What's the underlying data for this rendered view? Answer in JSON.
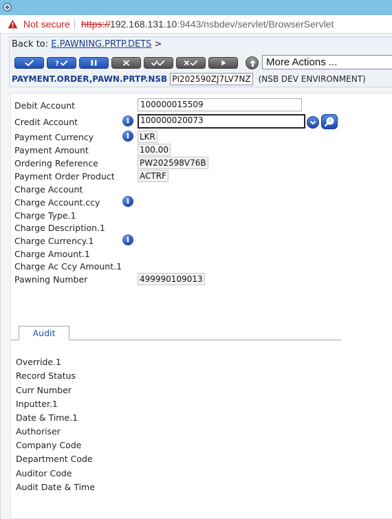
{
  "browser": {
    "security_label": "Not secure",
    "url_scheme": "https://",
    "url_host": "192.168.131.10",
    "url_path": ":9443/nsbdev/servlet/BrowserServlet"
  },
  "toolbar": {
    "back_prefix": "Back to:",
    "back_link": "E.PAWNING.PRTP.DETS",
    "back_suffix": ">",
    "more_actions": "More Actions ...",
    "buttons": [
      "commit-deal",
      "validate-deal",
      "hold-deal",
      "delete-deal",
      "authorise-deal",
      "reverse-deal",
      "next-record",
      "context-enquiry"
    ]
  },
  "header": {
    "app_title": "PAYMENT.ORDER,PAWN.PRTP.NSB",
    "record_id": "PI202590ZJ7LV7NZ",
    "environment": "(NSB DEV ENVIRONMENT)"
  },
  "fields": {
    "debit_account": {
      "label": "Debit Account",
      "value": "100000015509"
    },
    "credit_account": {
      "label": "Credit Account",
      "value": "100000020073"
    },
    "payment_currency": {
      "label": "Payment Currency",
      "value": "LKR"
    },
    "payment_amount": {
      "label": "Payment Amount",
      "value": "100.00"
    },
    "ordering_reference": {
      "label": "Ordering Reference",
      "value": "PW202598V76B"
    },
    "payment_order_product": {
      "label": "Payment Order Product",
      "value": "ACTRF"
    },
    "charge_account": {
      "label": "Charge Account"
    },
    "charge_account_ccy": {
      "label": "Charge Account.ccy"
    },
    "charge_type": {
      "label": "Charge Type.1"
    },
    "charge_description": {
      "label": "Charge Description.1"
    },
    "charge_currency": {
      "label": "Charge Currency.1"
    },
    "charge_amount": {
      "label": "Charge Amount.1"
    },
    "charge_ac_ccy_amount": {
      "label": "Charge Ac Ccy Amount.1"
    },
    "pawning_number": {
      "label": "Pawning Number",
      "value": "499990109013"
    }
  },
  "tabs": {
    "audit": "Audit"
  },
  "audit": {
    "override": "Override.1",
    "record_status": "Record Status",
    "curr_number": "Curr Number",
    "inputter": "Inputter.1",
    "date_time": "Date & Time.1",
    "authoriser": "Authoriser",
    "company_code": "Company Code",
    "department_code": "Department Code",
    "auditor_code": "Auditor Code",
    "audit_date_time": "Audit Date & Time"
  },
  "colors": {
    "titlebar": "#7ec3e6",
    "warning_red": "#c5221f",
    "link_blue": "#1c3f8c",
    "button_blue": "#1f4fb5",
    "button_gray": "#4e4e4e"
  }
}
